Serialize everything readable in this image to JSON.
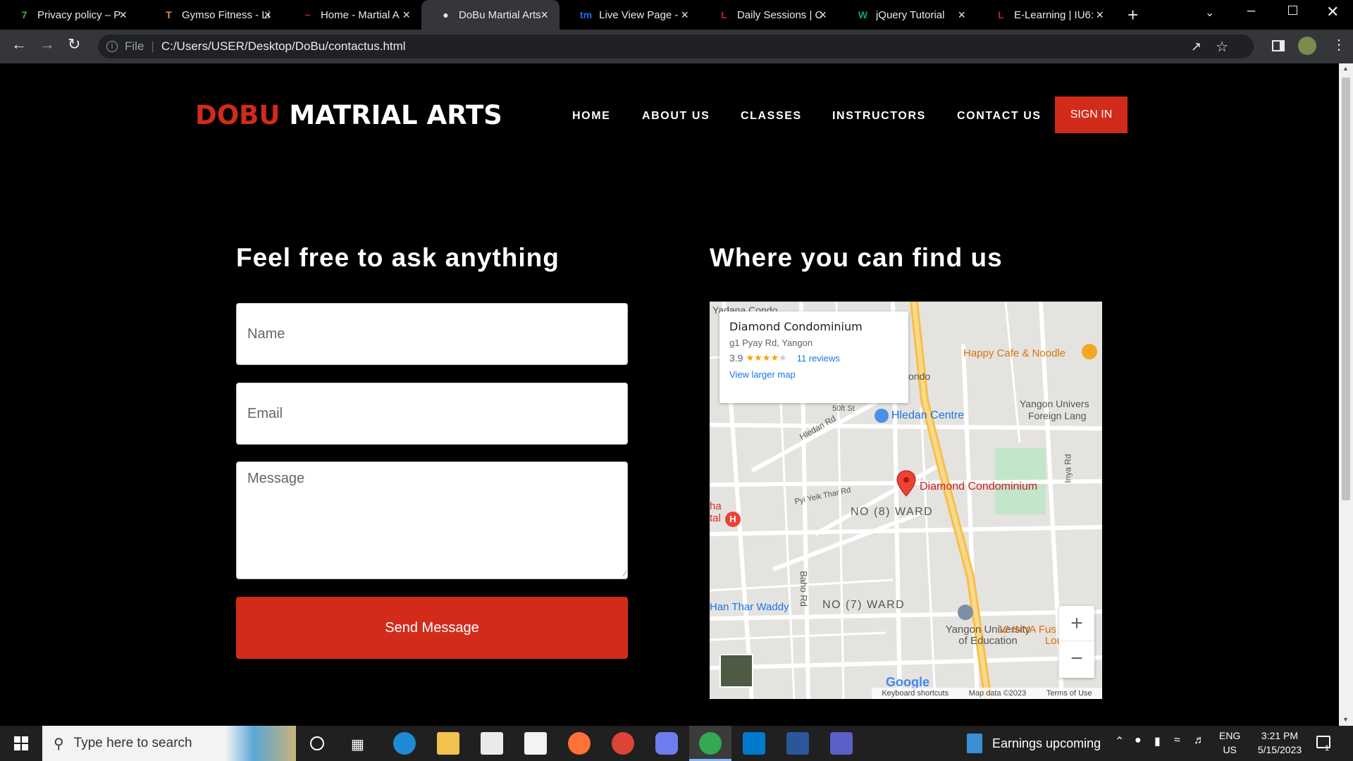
{
  "browser": {
    "tabs": [
      {
        "title": "Privacy policy – P",
        "icon": "number-seven-icon",
        "color": "#4caf50",
        "glyph": "7"
      },
      {
        "title": "Gymso Fitness - Li",
        "icon": "t-logo-icon",
        "color": "#f28b30",
        "glyph": "T"
      },
      {
        "title": "Home - Martial A",
        "icon": "martial-arts-icon",
        "color": "#d22b1a",
        "glyph": "~"
      },
      {
        "title": "DoBu Martial Arts",
        "icon": "globe-icon",
        "color": "#e8eaed",
        "glyph": "●"
      },
      {
        "title": "Live View Page - ",
        "icon": "tm-logo-icon",
        "color": "#1a73e8",
        "glyph": "tm"
      },
      {
        "title": "Daily Sessions | C",
        "icon": "l-logo-icon",
        "color": "#c2185b",
        "glyph": "L"
      },
      {
        "title": "jQuery Tutorial",
        "icon": "w3schools-icon",
        "color": "#04aa6d",
        "glyph": "W"
      },
      {
        "title": "E-Learning | IU6:",
        "icon": "l-logo-icon",
        "color": "#c2185b",
        "glyph": "L"
      }
    ],
    "active_tab_index": 3,
    "address": {
      "scheme_label": "File",
      "url": "C:/Users/USER/Desktop/DoBu/contactus.html"
    }
  },
  "site": {
    "logo": {
      "part1": "DOBU",
      "part2": "MATRIAL ARTS"
    },
    "nav": [
      "HOME",
      "ABOUT US",
      "CLASSES",
      "INSTRUCTORS",
      "CONTACT US"
    ],
    "signin": "SIGN IN",
    "contact": {
      "heading": "Feel free to ask anything",
      "name_placeholder": "Name",
      "email_placeholder": "Email",
      "message_placeholder": "Message",
      "send_label": "Send Message"
    },
    "location": {
      "heading": "Where you can find us",
      "map": {
        "place_name": "Diamond Condominium",
        "address": "g1 Pyay Rd, Yangon",
        "rating": "3.9",
        "stars_filled": 4,
        "reviews": "11 reviews",
        "larger_map": "View larger map",
        "labels": {
          "cafe": "Happy Cafe & Noodle",
          "hledan": "Hledan Centre",
          "hledan_rd": "Hledan Rd",
          "pin": "Diamond Condominium",
          "ward8": "NO (8) WARD",
          "ward7": "NO (7) WARD",
          "baho": "Baho Rd",
          "inya": "Inya Rd",
          "univ1": "Yangon Univers",
          "univ2": "Foreign Lang",
          "yu": "Yangon University of Education",
          "inya12": "12 INYA Fus & Lour",
          "hanthar": "Han Thar Waddy",
          "pyi": "Pyi Yeik Thar Rd",
          "fiftieth": "50ft St",
          "condo_top": "Yadana Condo",
          "condo_frag": "ondo",
          "hospital": "ha tal",
          "google": "Google"
        },
        "footer": [
          "Keyboard shortcuts",
          "Map data ©2023",
          "Terms of Use"
        ]
      }
    }
  },
  "taskbar": {
    "search_placeholder": "Type here to search",
    "widget": "Earnings upcoming",
    "lang1": "ENG",
    "lang2": "US",
    "time": "3:21 PM",
    "date": "5/15/2023",
    "notif_count": "1"
  },
  "colors": {
    "accent": "#d22b1a",
    "page_bg": "#000000"
  }
}
